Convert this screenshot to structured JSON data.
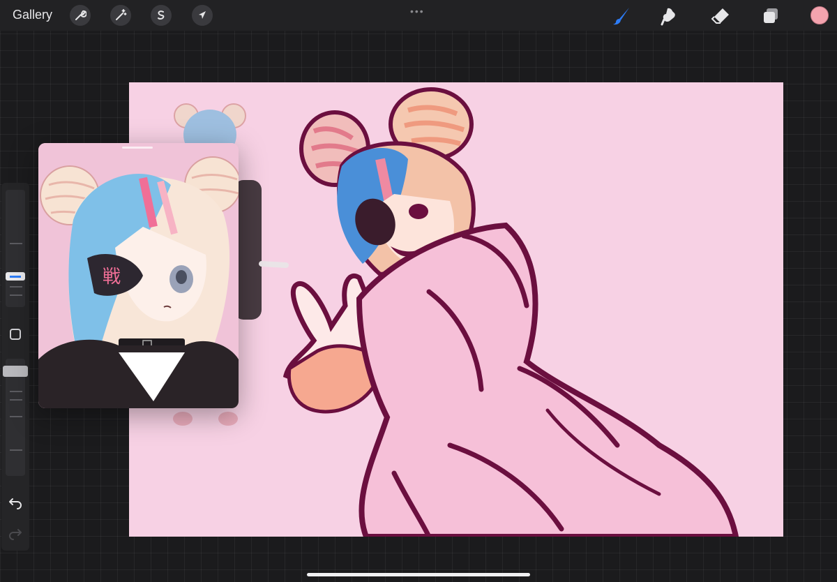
{
  "topbar": {
    "gallery_label": "Gallery",
    "actions_tools": [
      "wrench-icon",
      "magic-wand-icon",
      "selection-icon",
      "transform-arrow-icon"
    ],
    "drag_handle": "•••",
    "paint_tools": [
      "brush-icon",
      "smudge-icon",
      "eraser-icon",
      "layers-icon"
    ],
    "current_color": "#f3a3ae",
    "active_tool_color": "#2d7cf6"
  },
  "canvas": {
    "background": "#f7d1e4",
    "line_color": "#6b0f3f"
  },
  "reference": {
    "background": "#f0c3d8",
    "eyepatch_text": "戦"
  },
  "sidebar": {
    "brush_size_color": "#2d7cf6",
    "opacity_color": "#b9b9bd",
    "undo_icon": "undo-icon",
    "redo_icon": "redo-icon"
  }
}
